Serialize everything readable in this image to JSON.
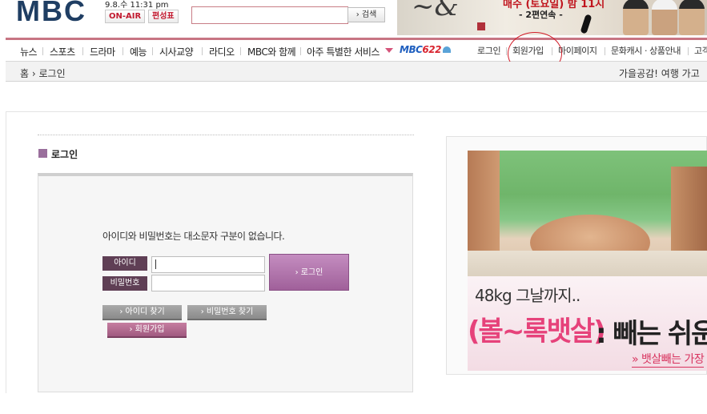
{
  "header": {
    "logo_text": "MBC",
    "datetime": "9.8.수 11:31 pm",
    "onair_label": "ON-AIR",
    "schedule_label": "편성표",
    "search": {
      "value": "",
      "placeholder": ""
    },
    "search_button": "› 검색",
    "banner": {
      "line1": "매주 (토요일) 밤 11시",
      "line2": "- 2편연속 -"
    }
  },
  "nav": {
    "items": [
      "뉴스",
      "스포츠",
      "드라마",
      "예능",
      "시사교양",
      "라디오",
      "MBC와 함께",
      "아주 특별한 서비스"
    ],
    "brand": {
      "prefix": "MBC",
      "suffix": "622"
    },
    "util": [
      "로그인",
      "회원가입",
      "마이페이지",
      "문화캐시 · 상품안내",
      "고객"
    ]
  },
  "breadcrumb": {
    "home": "홈",
    "current": "로그인"
  },
  "promo_text": "가을공감! 여행 가고",
  "login": {
    "section_title": "로그인",
    "notice": "아이디와 비밀번호는 대소문자 구분이 없습니다.",
    "id_label": "아이디",
    "id_value": "",
    "pw_label": "비밀번호",
    "pw_value": "",
    "submit": "› 로그인",
    "find_id": "› 아이디 찾기",
    "find_pw": "› 비밀번호 찾기",
    "join": "› 회원가입"
  },
  "ad": {
    "line1": "48kg 그날까지..",
    "line2_pink": "(볼~록뱃살)",
    "line2_dark": ": 빼는 쉬운",
    "link": "» 뱃살빼는 가장"
  },
  "colors": {
    "accent": "#c77583",
    "label_bg": "#5f3f55",
    "login_btn": "#a0609a",
    "annotation": "#d21f2b"
  }
}
